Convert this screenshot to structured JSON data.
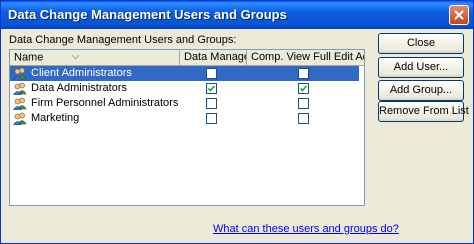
{
  "window": {
    "title": "Data Change Management Users and Groups"
  },
  "list": {
    "label": "Data Change Management Users and Groups:",
    "columns": [
      "Name",
      "Data Manager",
      "Comp. View Full Edit Access"
    ],
    "rows": [
      {
        "name": "Client Administrators",
        "data_manager": false,
        "comp_view_full_edit": false,
        "selected": true
      },
      {
        "name": "Data Administrators",
        "data_manager": true,
        "comp_view_full_edit": true,
        "selected": false
      },
      {
        "name": "Firm Personnel Administrators",
        "data_manager": false,
        "comp_view_full_edit": false,
        "selected": false
      },
      {
        "name": "Marketing",
        "data_manager": false,
        "comp_view_full_edit": false,
        "selected": false
      }
    ]
  },
  "buttons": {
    "close": "Close",
    "add_user": "Add User...",
    "add_group": "Add Group...",
    "remove": "Remove From List"
  },
  "help_link": "What can these users and groups do?",
  "colors": {
    "selection": "#316ac5",
    "titlebar": "#0a5ee0",
    "link": "#0000ff"
  },
  "icons": {
    "group": "users-group-icon",
    "sort": "sort-ascending-icon",
    "close": "close-icon",
    "check": "checkmark-icon"
  }
}
